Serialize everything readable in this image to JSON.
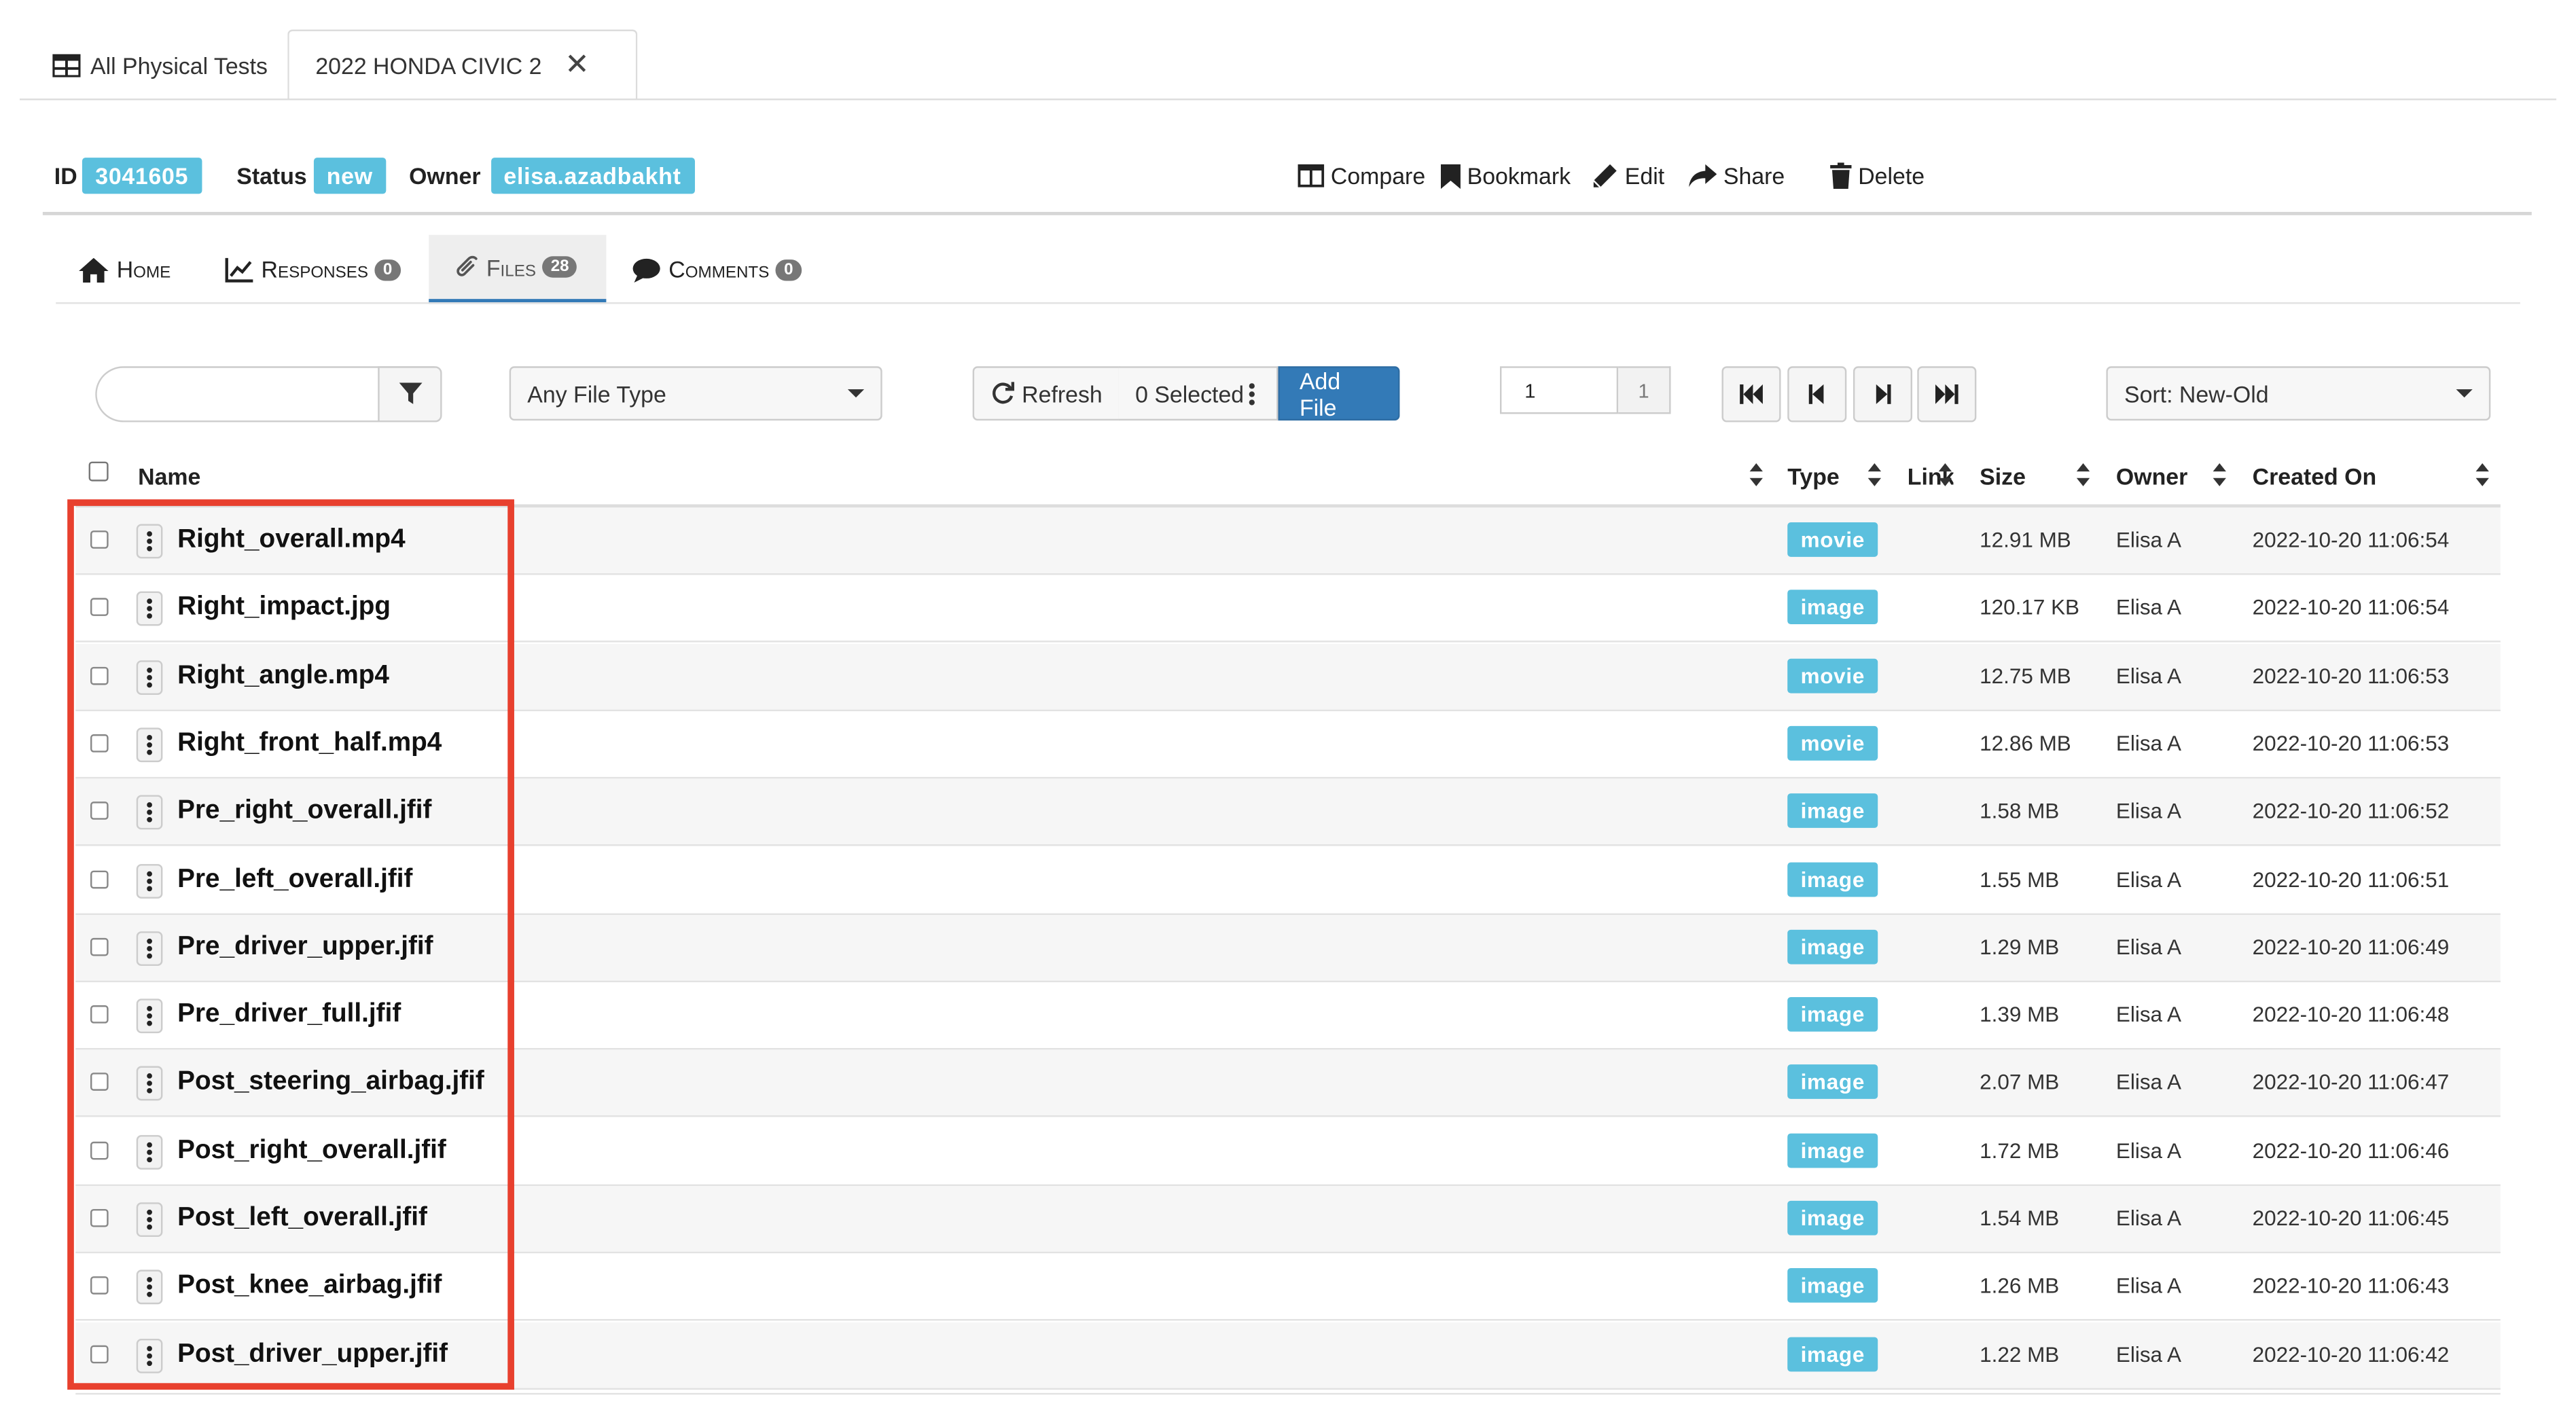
{
  "tabs": {
    "all_tests_label": "All Physical Tests",
    "current_label": "2022 HONDA CIVIC 2",
    "close_symbol": "✕"
  },
  "meta": {
    "id_label": "ID",
    "id_value": "3041605",
    "status_label": "Status",
    "status_value": "new",
    "owner_label": "Owner",
    "owner_value": "elisa.azadbakht",
    "badge_color": "#5bc0de"
  },
  "actions": {
    "compare": "Compare",
    "bookmark": "Bookmark",
    "edit": "Edit",
    "share": "Share",
    "delete": "Delete"
  },
  "nav": {
    "home": "Home",
    "responses": "Responses",
    "responses_count": "0",
    "files": "Files",
    "files_count": "28",
    "comments": "Comments",
    "comments_count": "0"
  },
  "toolbar": {
    "search_placeholder": "",
    "file_type": "Any File Type",
    "refresh": "Refresh",
    "selected": "0 Selected",
    "add_file": "Add File",
    "page_value": "1",
    "page_total": "1",
    "sort": "Sort: New-Old",
    "primary_color": "#337ab7"
  },
  "columns": {
    "name": "Name",
    "type": "Type",
    "link": "Link",
    "size": "Size",
    "owner": "Owner",
    "created": "Created On"
  },
  "files": [
    {
      "name": "Right_overall.mp4",
      "type": "movie",
      "size": "12.91 MB",
      "owner": "Elisa A",
      "created": "2022-10-20 11:06:54"
    },
    {
      "name": "Right_impact.jpg",
      "type": "image",
      "size": "120.17 KB",
      "owner": "Elisa A",
      "created": "2022-10-20 11:06:54"
    },
    {
      "name": "Right_angle.mp4",
      "type": "movie",
      "size": "12.75 MB",
      "owner": "Elisa A",
      "created": "2022-10-20 11:06:53"
    },
    {
      "name": "Right_front_half.mp4",
      "type": "movie",
      "size": "12.86 MB",
      "owner": "Elisa A",
      "created": "2022-10-20 11:06:53"
    },
    {
      "name": "Pre_right_overall.jfif",
      "type": "image",
      "size": "1.58 MB",
      "owner": "Elisa A",
      "created": "2022-10-20 11:06:52"
    },
    {
      "name": "Pre_left_overall.jfif",
      "type": "image",
      "size": "1.55 MB",
      "owner": "Elisa A",
      "created": "2022-10-20 11:06:51"
    },
    {
      "name": "Pre_driver_upper.jfif",
      "type": "image",
      "size": "1.29 MB",
      "owner": "Elisa A",
      "created": "2022-10-20 11:06:49"
    },
    {
      "name": "Pre_driver_full.jfif",
      "type": "image",
      "size": "1.39 MB",
      "owner": "Elisa A",
      "created": "2022-10-20 11:06:48"
    },
    {
      "name": "Post_steering_airbag.jfif",
      "type": "image",
      "size": "2.07 MB",
      "owner": "Elisa A",
      "created": "2022-10-20 11:06:47"
    },
    {
      "name": "Post_right_overall.jfif",
      "type": "image",
      "size": "1.72 MB",
      "owner": "Elisa A",
      "created": "2022-10-20 11:06:46"
    },
    {
      "name": "Post_left_overall.jfif",
      "type": "image",
      "size": "1.54 MB",
      "owner": "Elisa A",
      "created": "2022-10-20 11:06:45"
    },
    {
      "name": "Post_knee_airbag.jfif",
      "type": "image",
      "size": "1.26 MB",
      "owner": "Elisa A",
      "created": "2022-10-20 11:06:43"
    },
    {
      "name": "Post_driver_upper.jfif",
      "type": "image",
      "size": "1.22 MB",
      "owner": "Elisa A",
      "created": "2022-10-20 11:06:42"
    }
  ],
  "icons": {
    "table": "table-icon",
    "close": "close-icon",
    "compare": "columns-icon",
    "bookmark": "bookmark-icon",
    "edit": "pencil-icon",
    "share": "share-icon",
    "delete": "trash-icon",
    "home": "home-icon",
    "responses": "line-chart-icon",
    "files": "paperclip-icon",
    "comments": "comment-icon",
    "filter": "filter-icon",
    "refresh": "refresh-icon",
    "first": "first-page-icon",
    "prev": "previous-page-icon",
    "next": "next-page-icon",
    "last": "last-page-icon",
    "row_menu": "vertical-ellipsis-icon"
  },
  "highlight_color": "#e8402e"
}
